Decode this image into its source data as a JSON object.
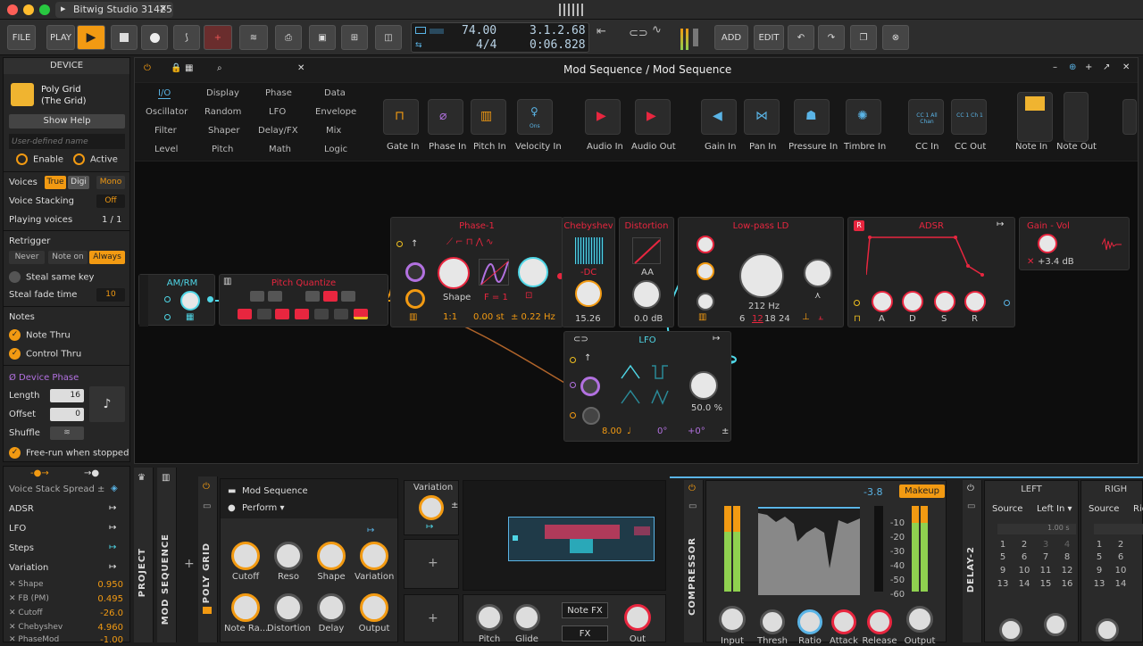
{
  "app": {
    "window_title": "Bitwig Studio 31425"
  },
  "transport": {
    "file": "FILE",
    "play": "PLAY",
    "add": "ADD",
    "edit": "EDIT",
    "tempo": "74.00",
    "time_sig": "4/4",
    "position": "3.1.2.68",
    "time": "0:06.828"
  },
  "device_panel": {
    "title": "DEVICE",
    "device_name": "Poly Grid",
    "device_sub": "(The Grid)",
    "show_help": "Show Help",
    "name_placeholder": "User-defined name",
    "enable": "Enable",
    "active": "Active",
    "voices_label": "Voices",
    "voices_opts": [
      "True",
      "Digi",
      "Mono"
    ],
    "voice_stacking_label": "Voice Stacking",
    "voice_stacking_val": "Off",
    "playing_voices_label": "Playing voices",
    "playing_voices_val": "1 / 1",
    "retrigger_label": "Retrigger",
    "retrigger_opts": [
      "Never",
      "Note on",
      "Always"
    ],
    "steal_same_key": "Steal same key",
    "steal_fade_label": "Steal fade time",
    "steal_fade_val": "10",
    "notes_label": "Notes",
    "note_thru": "Note Thru",
    "control_thru": "Control Thru",
    "device_phase_label": "Ø Device Phase",
    "length_label": "Length",
    "length_val": "16",
    "offset_label": "Offset",
    "offset_val": "0",
    "shuffle_label": "Shuffle",
    "free_run": "Free-run when stopped"
  },
  "grid": {
    "title": "Mod Sequence / Mod Sequence",
    "categories": [
      "I/O",
      "Display",
      "Phase",
      "Data",
      "Oscillator",
      "Random",
      "LFO",
      "Envelope",
      "Filter",
      "Shaper",
      "Delay/FX",
      "Mix",
      "Level",
      "Pitch",
      "Math",
      "Logic"
    ],
    "io_modules": [
      "Gate In",
      "Phase In",
      "Pitch In",
      "Velocity In",
      "Audio In",
      "Audio Out",
      "Gain In",
      "Pan In",
      "Pressure In",
      "Timbre In",
      "CC In",
      "CC Out",
      "Note In",
      "Note Out"
    ],
    "cc_in_tile": "CC 1 All Chan",
    "cc_out_tile": "CC 1 Ch 1",
    "velocity_tile": "Ons",
    "modules": {
      "am_rm": "AM/RM",
      "pitch_quantize": "Pitch Quantize",
      "phase1": "Phase-1",
      "phase1_shape": "Shape",
      "phase1_f": "F = 1",
      "phase1_ratio": "1:1",
      "phase1_st": "0.00  st",
      "phase1_hz": "± 0.22 Hz",
      "cheby": "Chebyshev",
      "cheby_dc": "-DC",
      "cheby_val": "15.26",
      "dist": "Distortion",
      "dist_aa": "AA",
      "dist_val": "0.0 dB",
      "lpf": "Low-pass LD",
      "lpf_freq": "212 Hz",
      "lpf_slopes": [
        "6",
        "12",
        "18",
        "24"
      ],
      "adsr": "ADSR",
      "adsr_r_badge": "R",
      "adsr_knobs": [
        "A",
        "D",
        "S",
        "R"
      ],
      "gain": "Gain - Vol",
      "gain_val": "+3.4 dB",
      "lfo": "LFO",
      "lfo_rate": "8.00",
      "lfo_phase": "0°",
      "lfo_offset": "+0°",
      "lfo_val": "50.0 %"
    }
  },
  "bottom": {
    "voice_stack_spread": "Voice Stack Spread ±",
    "mod_rows": [
      "ADSR",
      "LFO",
      "Steps",
      "Variation"
    ],
    "params": [
      {
        "name": "Shape",
        "val": "0.950"
      },
      {
        "name": "FB (PM)",
        "val": "0.495"
      },
      {
        "name": "Cutoff",
        "val": "-26.0"
      },
      {
        "name": "Chebyshev",
        "val": "4.960"
      },
      {
        "name": "PhaseMod",
        "val": "-1.00"
      }
    ],
    "vtabs": [
      "PROJECT",
      "MOD SEQUENCE",
      "POLY GRID",
      "COMPRESSOR",
      "DELAY-2"
    ],
    "mod_seq_name": "Mod Sequence",
    "perform": "Perform",
    "knobs_row1": [
      "Cutoff",
      "Reso",
      "Shape",
      "Variation"
    ],
    "knobs_row2": [
      "Note Ra...",
      "Distortion",
      "Delay",
      "Output"
    ],
    "variation_label": "Variation",
    "pitch": "Pitch",
    "glide": "Glide",
    "note_fx": "Note FX",
    "fx": "FX",
    "out": "Out",
    "compressor": {
      "gain_readout": "-3.8",
      "makeup": "Makeup",
      "scale": [
        "-10",
        "-20",
        "-30",
        "-40",
        "-50",
        "-60"
      ],
      "knobs": [
        "Input",
        "Thresh",
        "Ratio",
        "Attack",
        "Release",
        "Output"
      ]
    },
    "delay": {
      "left": "LEFT",
      "right": "RIGH",
      "source": "Source",
      "left_in": "Left In",
      "right_in": "Righ",
      "time": "1.00 s",
      "grid_left": [
        [
          "1",
          "2",
          "3",
          "4"
        ],
        [
          "5",
          "6",
          "7",
          "8"
        ],
        [
          "9",
          "10",
          "11",
          "12"
        ],
        [
          "13",
          "14",
          "15",
          "16"
        ]
      ],
      "grid_right": [
        [
          "1",
          "2"
        ],
        [
          "5",
          "6"
        ],
        [
          "9",
          "10"
        ],
        [
          "13",
          "14"
        ]
      ]
    }
  },
  "colors": {
    "accent": "#f29a12",
    "port_red": "#e8263f",
    "cable_blue": "#4fd6e6",
    "purple": "#b271e0"
  }
}
